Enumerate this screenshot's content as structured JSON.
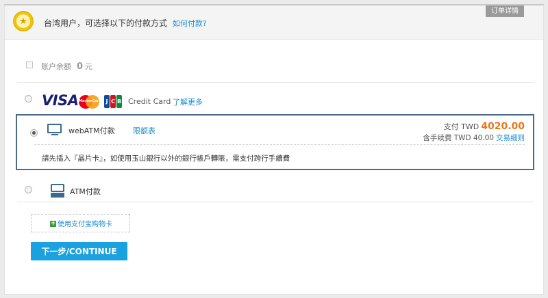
{
  "header": {
    "text": "台湾用户，可选择以下的付款方式",
    "help_link": "如何付款?",
    "order_details_tab": "订单详情"
  },
  "balance": {
    "label": "账户余额",
    "value": "0",
    "unit": "元"
  },
  "credit_card": {
    "brands": [
      "VISA",
      "MasterCard",
      "JCB"
    ],
    "label": "Credit Card",
    "more_link": "了解更多",
    "mastercard_text": "MasterCard",
    "jcb_letters": [
      "J",
      "C",
      "B"
    ],
    "jcb_colors": [
      "#0a4f9e",
      "#d6121f",
      "#0a8a3c"
    ]
  },
  "webatm": {
    "label": "webATM付款",
    "limit_link": "限额表",
    "pay_label": "支付 TWD",
    "pay_amount": "4020.00",
    "fee_text": "含手续费 TWD 40.00",
    "fee_link": "交易细则",
    "notice": "請先插入『晶片卡』，如使用玉山銀行以外的銀行帳戶轉賬，需支付跨行手續費",
    "selected": true
  },
  "atm": {
    "label": "ATM付款"
  },
  "giftcard": {
    "label": "使用支付宝购物卡"
  },
  "continue_button": "下一步/CONTINUE",
  "colors": {
    "link": "#1b8ccd",
    "amount": "#e8771b",
    "button": "#1aa1e0",
    "selected_border": "#4a6a8a",
    "badge": "#f1c40f"
  }
}
